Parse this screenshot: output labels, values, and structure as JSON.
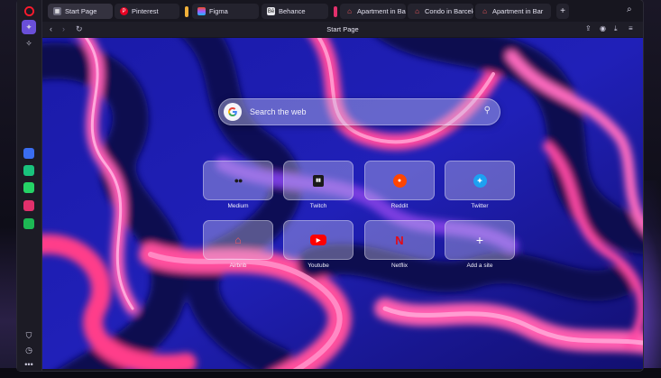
{
  "tabs": [
    {
      "label": "Start Page",
      "icon": "grid-icon",
      "color": "#6d6c7d",
      "active": true
    },
    {
      "label": "Pinterest",
      "icon": "pinterest-icon",
      "color": "#e60023"
    },
    {
      "label": "Figma",
      "icon": "figma-icon",
      "color": "#1abcfe"
    },
    {
      "label": "Behance",
      "icon": "behance-icon",
      "color": "#e8e8ee",
      "glyph": "Bē"
    },
    {
      "label": "Apartment in Bar",
      "icon": "airbnb-icon",
      "color": "#ff5a5f"
    },
    {
      "label": "Condo in Barcelo",
      "icon": "airbnb-icon",
      "color": "#ff5a5f"
    },
    {
      "label": "Apartment in Bar",
      "icon": "airbnb-icon",
      "color": "#ff5a5f"
    }
  ],
  "address_bar": {
    "title": "Start Page"
  },
  "search": {
    "placeholder": "Search the web"
  },
  "speed_dials": [
    {
      "label": "Medium",
      "icon": "medium-icon",
      "glyph": "●●",
      "color": "#1b1b1b"
    },
    {
      "label": "Twitch",
      "icon": "twitch-icon",
      "glyph": "▮▮",
      "color": "#1a1a1a"
    },
    {
      "label": "Reddit",
      "icon": "reddit-icon",
      "glyph": "●",
      "color": "#ff4500"
    },
    {
      "label": "Twitter",
      "icon": "twitter-icon",
      "glyph": "✦",
      "color": "#1da1f2"
    },
    {
      "label": "Airbnb",
      "icon": "airbnb-icon",
      "glyph": "⌂",
      "color": "#ff5a5f"
    },
    {
      "label": "Youtube",
      "icon": "youtube-icon",
      "glyph": "▶",
      "color": "#ff0000"
    },
    {
      "label": "Netflix",
      "icon": "netflix-icon",
      "glyph": "N",
      "color": "#e50914"
    },
    {
      "label": "Add a site",
      "icon": "plus-icon",
      "glyph": "+",
      "color": "#ffffff"
    }
  ],
  "sidebar": {
    "apps": [
      {
        "icon": "app-store-icon",
        "color": "#3a6df0"
      },
      {
        "icon": "chatgpt-icon",
        "color": "#19c37d"
      },
      {
        "icon": "whatsapp-icon",
        "color": "#25d366"
      },
      {
        "icon": "instagram-icon",
        "color": "#e1306c"
      },
      {
        "icon": "spotify-icon",
        "color": "#1db954"
      }
    ]
  }
}
